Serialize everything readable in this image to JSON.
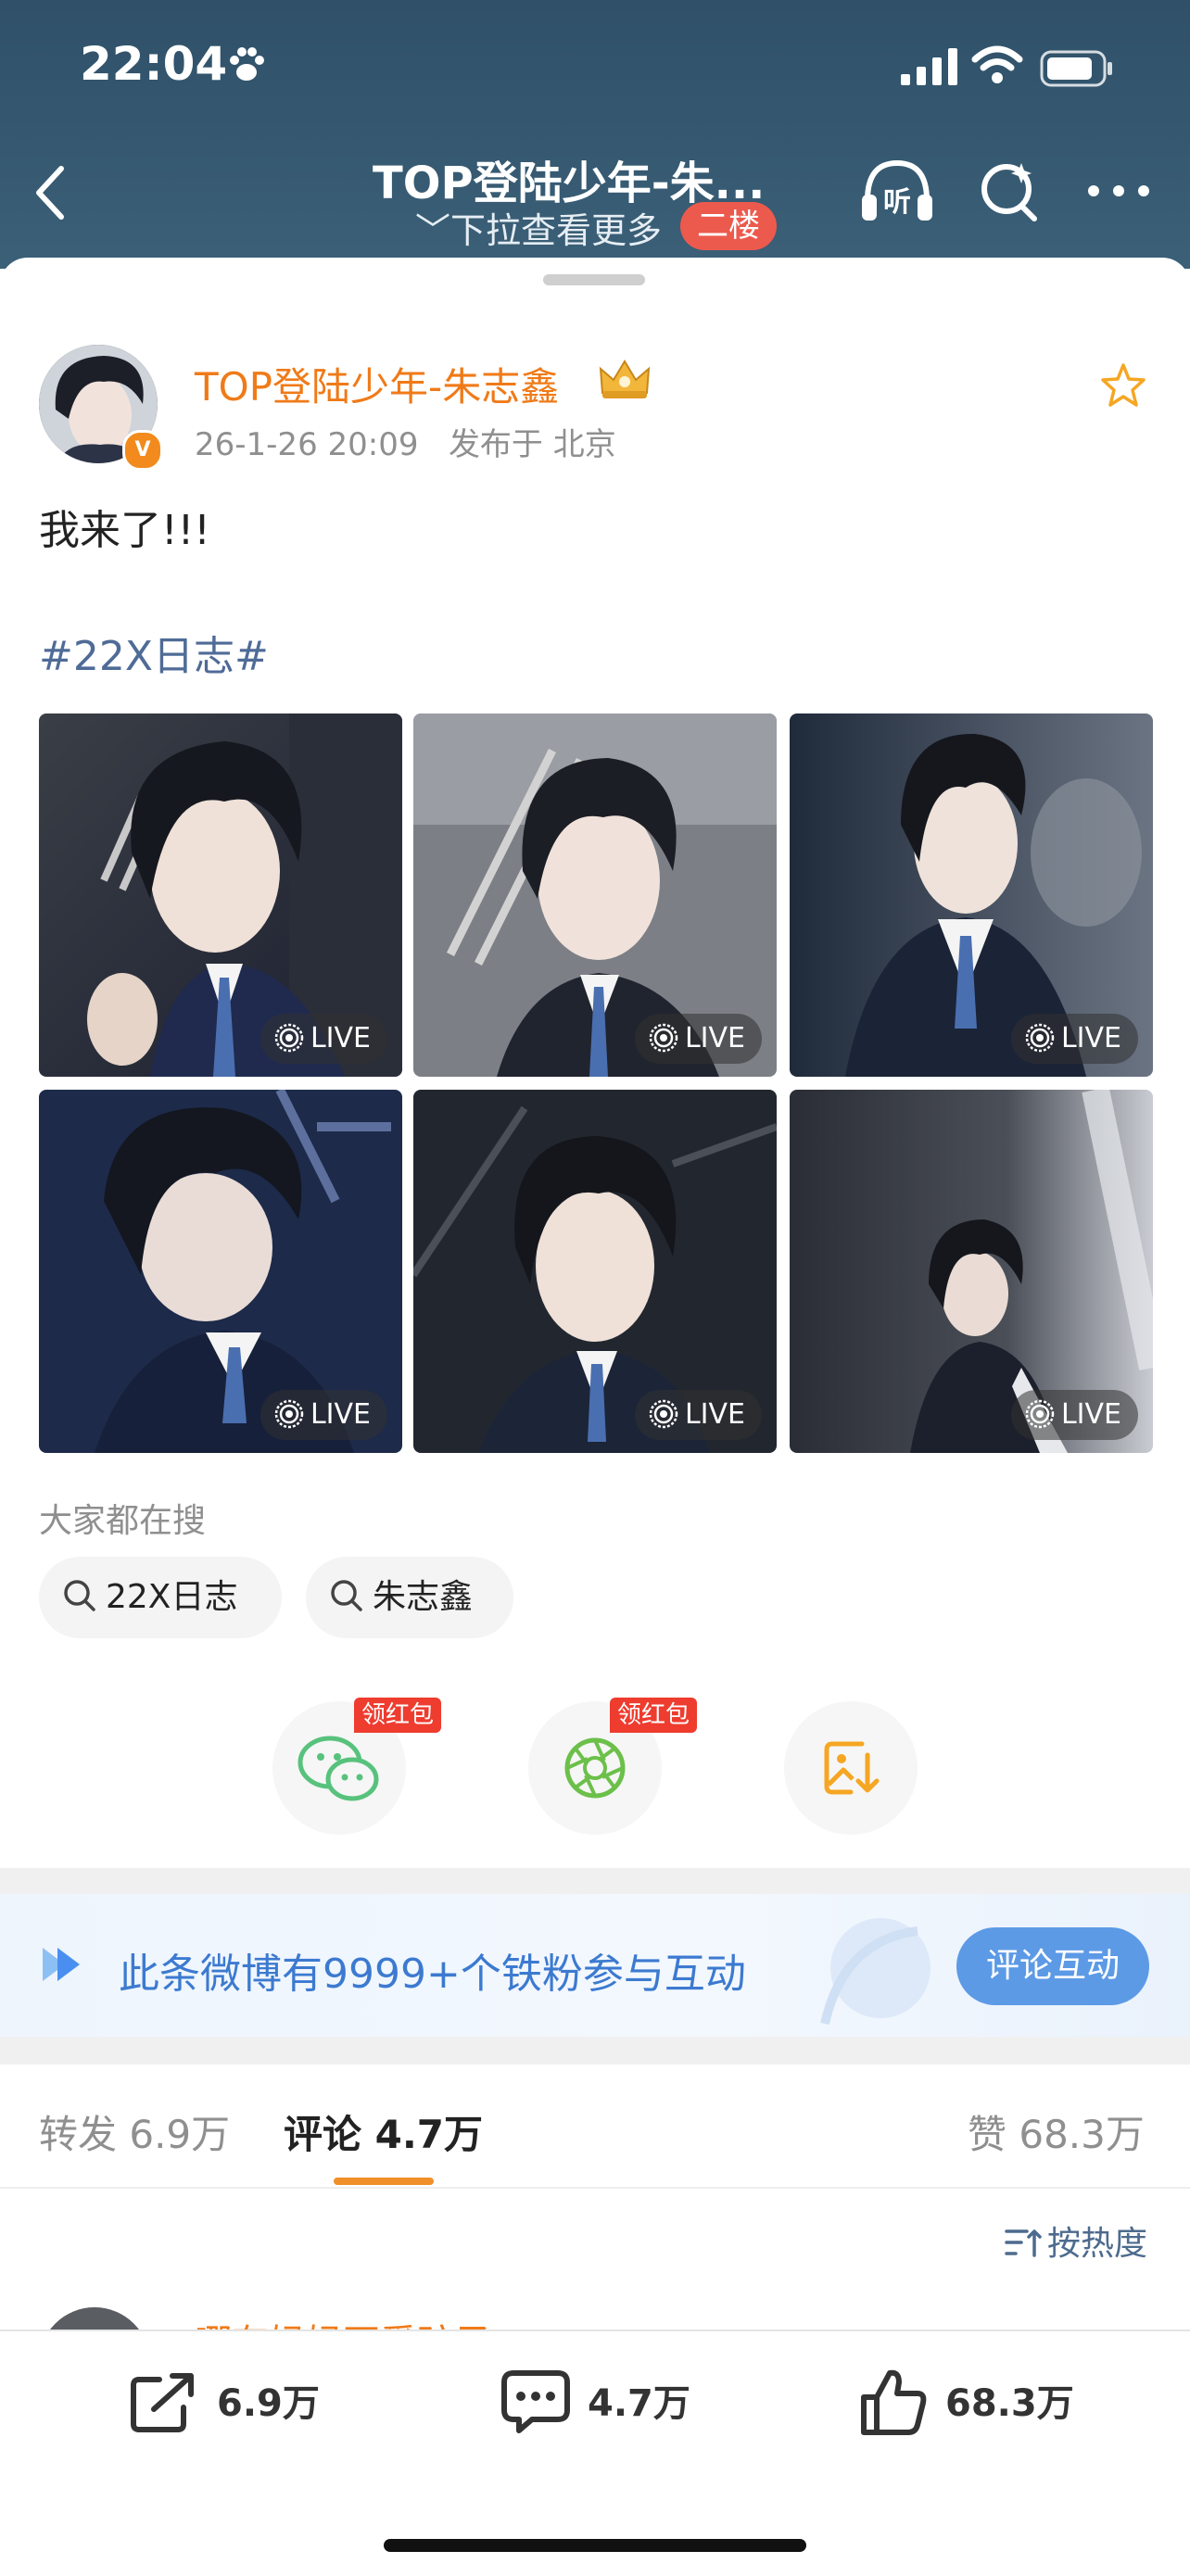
{
  "status_bar": {
    "time": "22:04",
    "paw_icon": "paw-icon"
  },
  "nav": {
    "title": "TOP登陆少年-朱...",
    "subtitle": "下拉查看更多",
    "floor_badge": "二楼",
    "listen_label": "听"
  },
  "post": {
    "author": "TOP登陆少年-朱志鑫",
    "verified_badge": "V",
    "timestamp": "26-1-26 20:09",
    "location": "发布于 北京",
    "text": "我来了!!!",
    "topic": "#22X日志#",
    "live_label": "LIVE",
    "photo_count": 6
  },
  "search": {
    "heading": "大家都在搜",
    "chips": [
      "22X日志",
      "朱志鑫"
    ]
  },
  "share": {
    "red_packet_label": "领红包",
    "buttons": [
      "wechat-icon",
      "moments-icon",
      "save-image-icon"
    ]
  },
  "banner": {
    "text": "此条微博有9999+个铁粉参与互动",
    "button": "评论互动"
  },
  "tabs": {
    "repost": "转发 6.9万",
    "comment": "评论 4.7万",
    "like": "赞 68.3万"
  },
  "sort_label": "按热度",
  "comment_preview": {
    "name_fragment": "哪有妈妈不爱孩子"
  },
  "bottom_bar": {
    "repost": "6.9万",
    "comment": "4.7万",
    "like": "68.3万"
  },
  "colors": {
    "header_bg": "#2f5068",
    "username": "#f07a18",
    "topic": "#4f6b97",
    "floor_badge": "#ec5a4d",
    "banner_button": "#5c9ae6",
    "tab_underline": "#f0902a"
  }
}
